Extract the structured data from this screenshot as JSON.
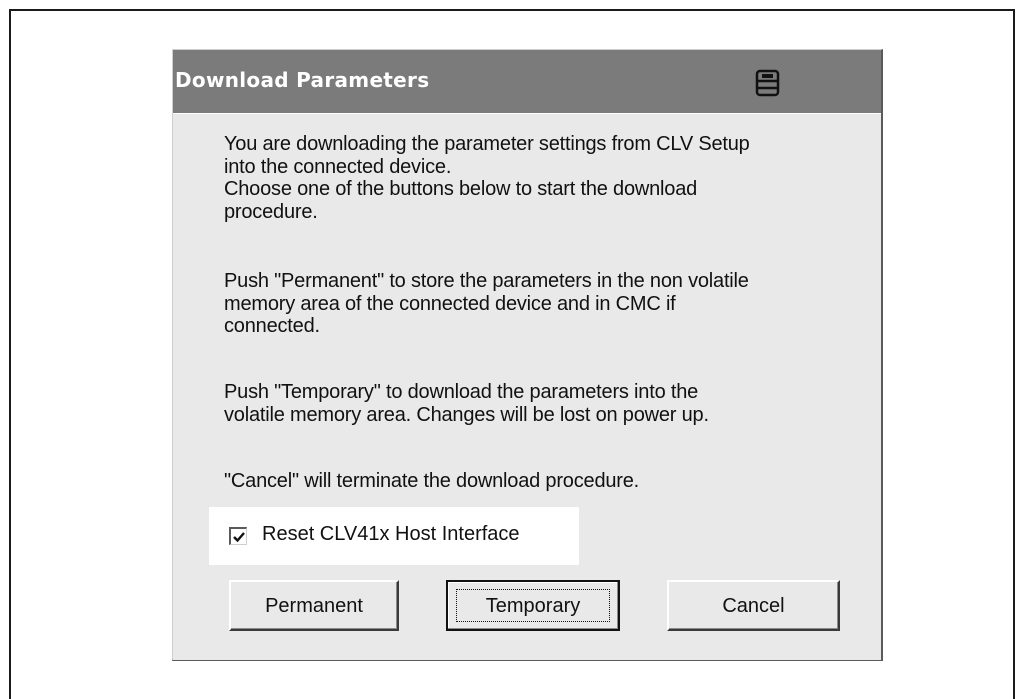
{
  "dialog": {
    "title": "Download Parameters",
    "title_icon": "window-icon",
    "paragraphs": [
      "You are downloading the parameter settings from CLV Setup\ninto the connected device.\nChoose one of the buttons below to start the download\nprocedure.",
      "Push \"Permanent\" to store the parameters in the non volatile\nmemory area of the connected device and in CMC if\nconnected.",
      "Push \"Temporary\" to download the parameters into the\nvolatile memory area. Changes will be lost on power up.",
      "\"Cancel\" will terminate the download procedure."
    ],
    "checkbox": {
      "label": "Reset CLV41x Host Interface",
      "checked": true
    },
    "buttons": {
      "permanent": "Permanent",
      "temporary": "Temporary",
      "cancel": "Cancel"
    },
    "colors": {
      "titlebar": "#7b7b7b",
      "panel": "#e9e9e9"
    }
  }
}
